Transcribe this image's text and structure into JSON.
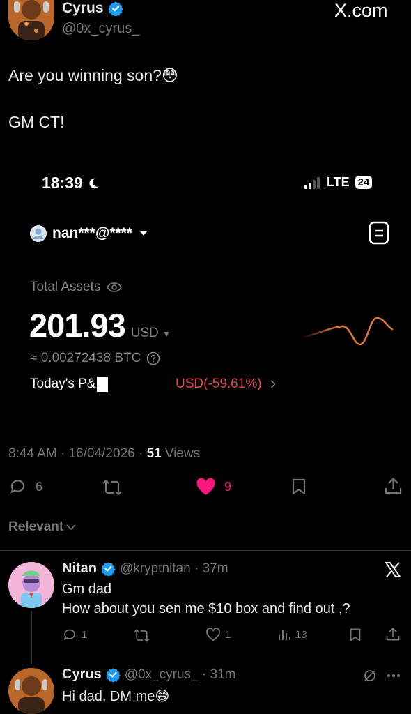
{
  "header": {
    "author_name": "Cyrus",
    "author_handle": "@0x_cyrus_",
    "watermark": "X.com"
  },
  "post": {
    "text_line1": "Are you winning son?😳",
    "text_line2": "GM CT!"
  },
  "embedded_screenshot": {
    "status_time": "18:39",
    "network": "LTE",
    "battery": "24",
    "account": "nan***@****",
    "total_assets_label": "Total Assets",
    "total_assets_value": "201.93",
    "currency": "USD",
    "btc_value": "≈ 0.00272438 BTC",
    "todays_pnl_label": "Today's P&",
    "todays_pnl_value": "USD(-59.61%)"
  },
  "meta": {
    "time": "8:44 AM",
    "date": "16/04/2026",
    "views_count": "51",
    "views_label": "Views"
  },
  "actions": {
    "replies": "6",
    "likes": "9"
  },
  "sort": {
    "label": "Relevant"
  },
  "replies": [
    {
      "name": "Nitan",
      "handle": "@kryptnitan",
      "age": "37m",
      "line1": "Gm dad",
      "line2": "How about you sen me $10 box and find out ,?",
      "reply_count": "1",
      "like_count": "1",
      "view_count": "13"
    },
    {
      "name": "Cyrus",
      "handle": "@0x_cyrus_",
      "age": "31m",
      "line1": "Hi dad, DM me😅"
    }
  ],
  "colors": {
    "accent_blue": "#1d9bf0",
    "like_pink": "#f91880",
    "loss_red": "#e5484d",
    "sparkline": "#d9783a"
  }
}
